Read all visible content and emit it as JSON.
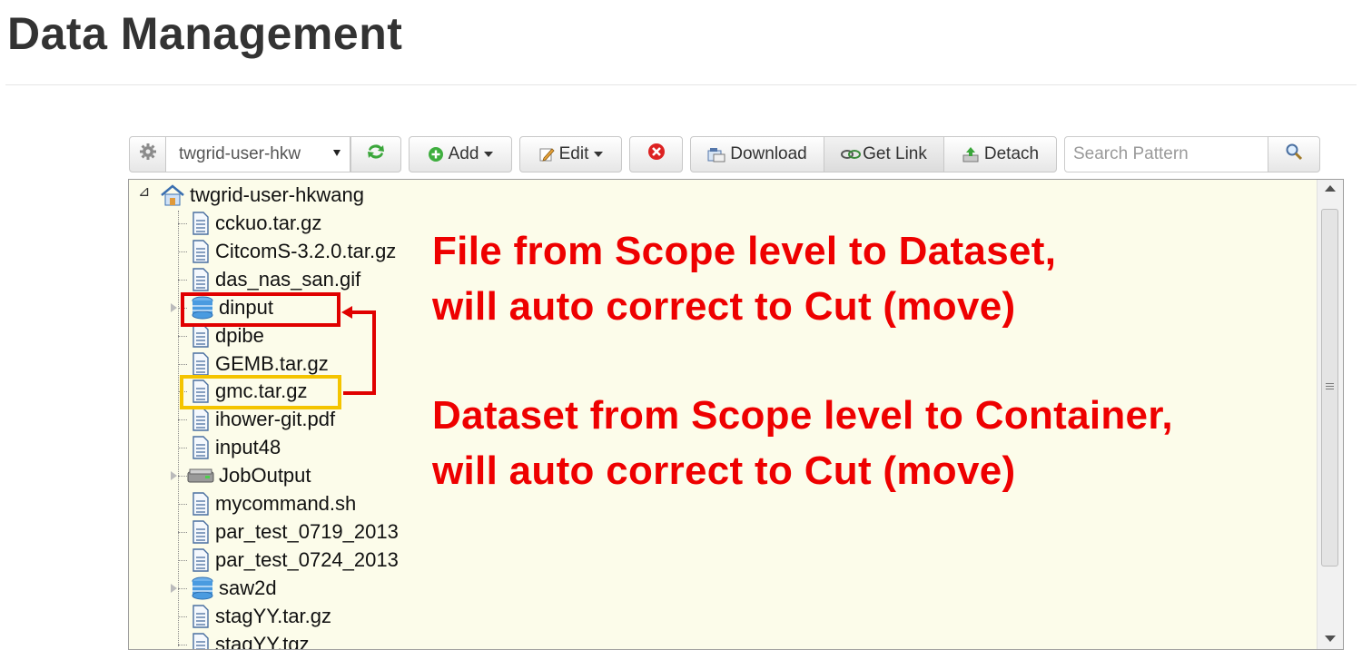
{
  "page": {
    "title": "Data Management"
  },
  "toolbar": {
    "scope_select_value": "twgrid-user-hkw",
    "add_label": "Add",
    "edit_label": "Edit",
    "download_label": "Download",
    "get_link_label": "Get Link",
    "detach_label": "Detach",
    "search_placeholder": "Search Pattern"
  },
  "tree": {
    "root": "twgrid-user-hkwang",
    "items": [
      {
        "label": "cckuo.tar.gz",
        "type": "file"
      },
      {
        "label": "CitcomS-3.2.0.tar.gz",
        "type": "file"
      },
      {
        "label": "das_nas_san.gif",
        "type": "file"
      },
      {
        "label": "dinput",
        "type": "dataset"
      },
      {
        "label": "dpibe",
        "type": "file"
      },
      {
        "label": "GEMB.tar.gz",
        "type": "file"
      },
      {
        "label": "gmc.tar.gz",
        "type": "file"
      },
      {
        "label": "ihower-git.pdf",
        "type": "file"
      },
      {
        "label": "input48",
        "type": "file"
      },
      {
        "label": "JobOutput",
        "type": "container"
      },
      {
        "label": "mycommand.sh",
        "type": "file"
      },
      {
        "label": "par_test_0719_2013",
        "type": "file"
      },
      {
        "label": "par_test_0724_2013",
        "type": "file"
      },
      {
        "label": "saw2d",
        "type": "dataset"
      },
      {
        "label": "stagYY.tar.gz",
        "type": "file"
      },
      {
        "label": "stagYY.tgz",
        "type": "file"
      }
    ]
  },
  "annotations": {
    "line1": "File from Scope level to Dataset,",
    "line2": "will auto correct to Cut (move)",
    "line3": "Dataset from Scope level to Container,",
    "line4": "will auto correct to Cut (move)"
  },
  "colors": {
    "annotation": "#ee0000",
    "highlight_dataset": "#e00000",
    "highlight_file": "#f4c400",
    "tree_bg": "#fcfcea"
  }
}
